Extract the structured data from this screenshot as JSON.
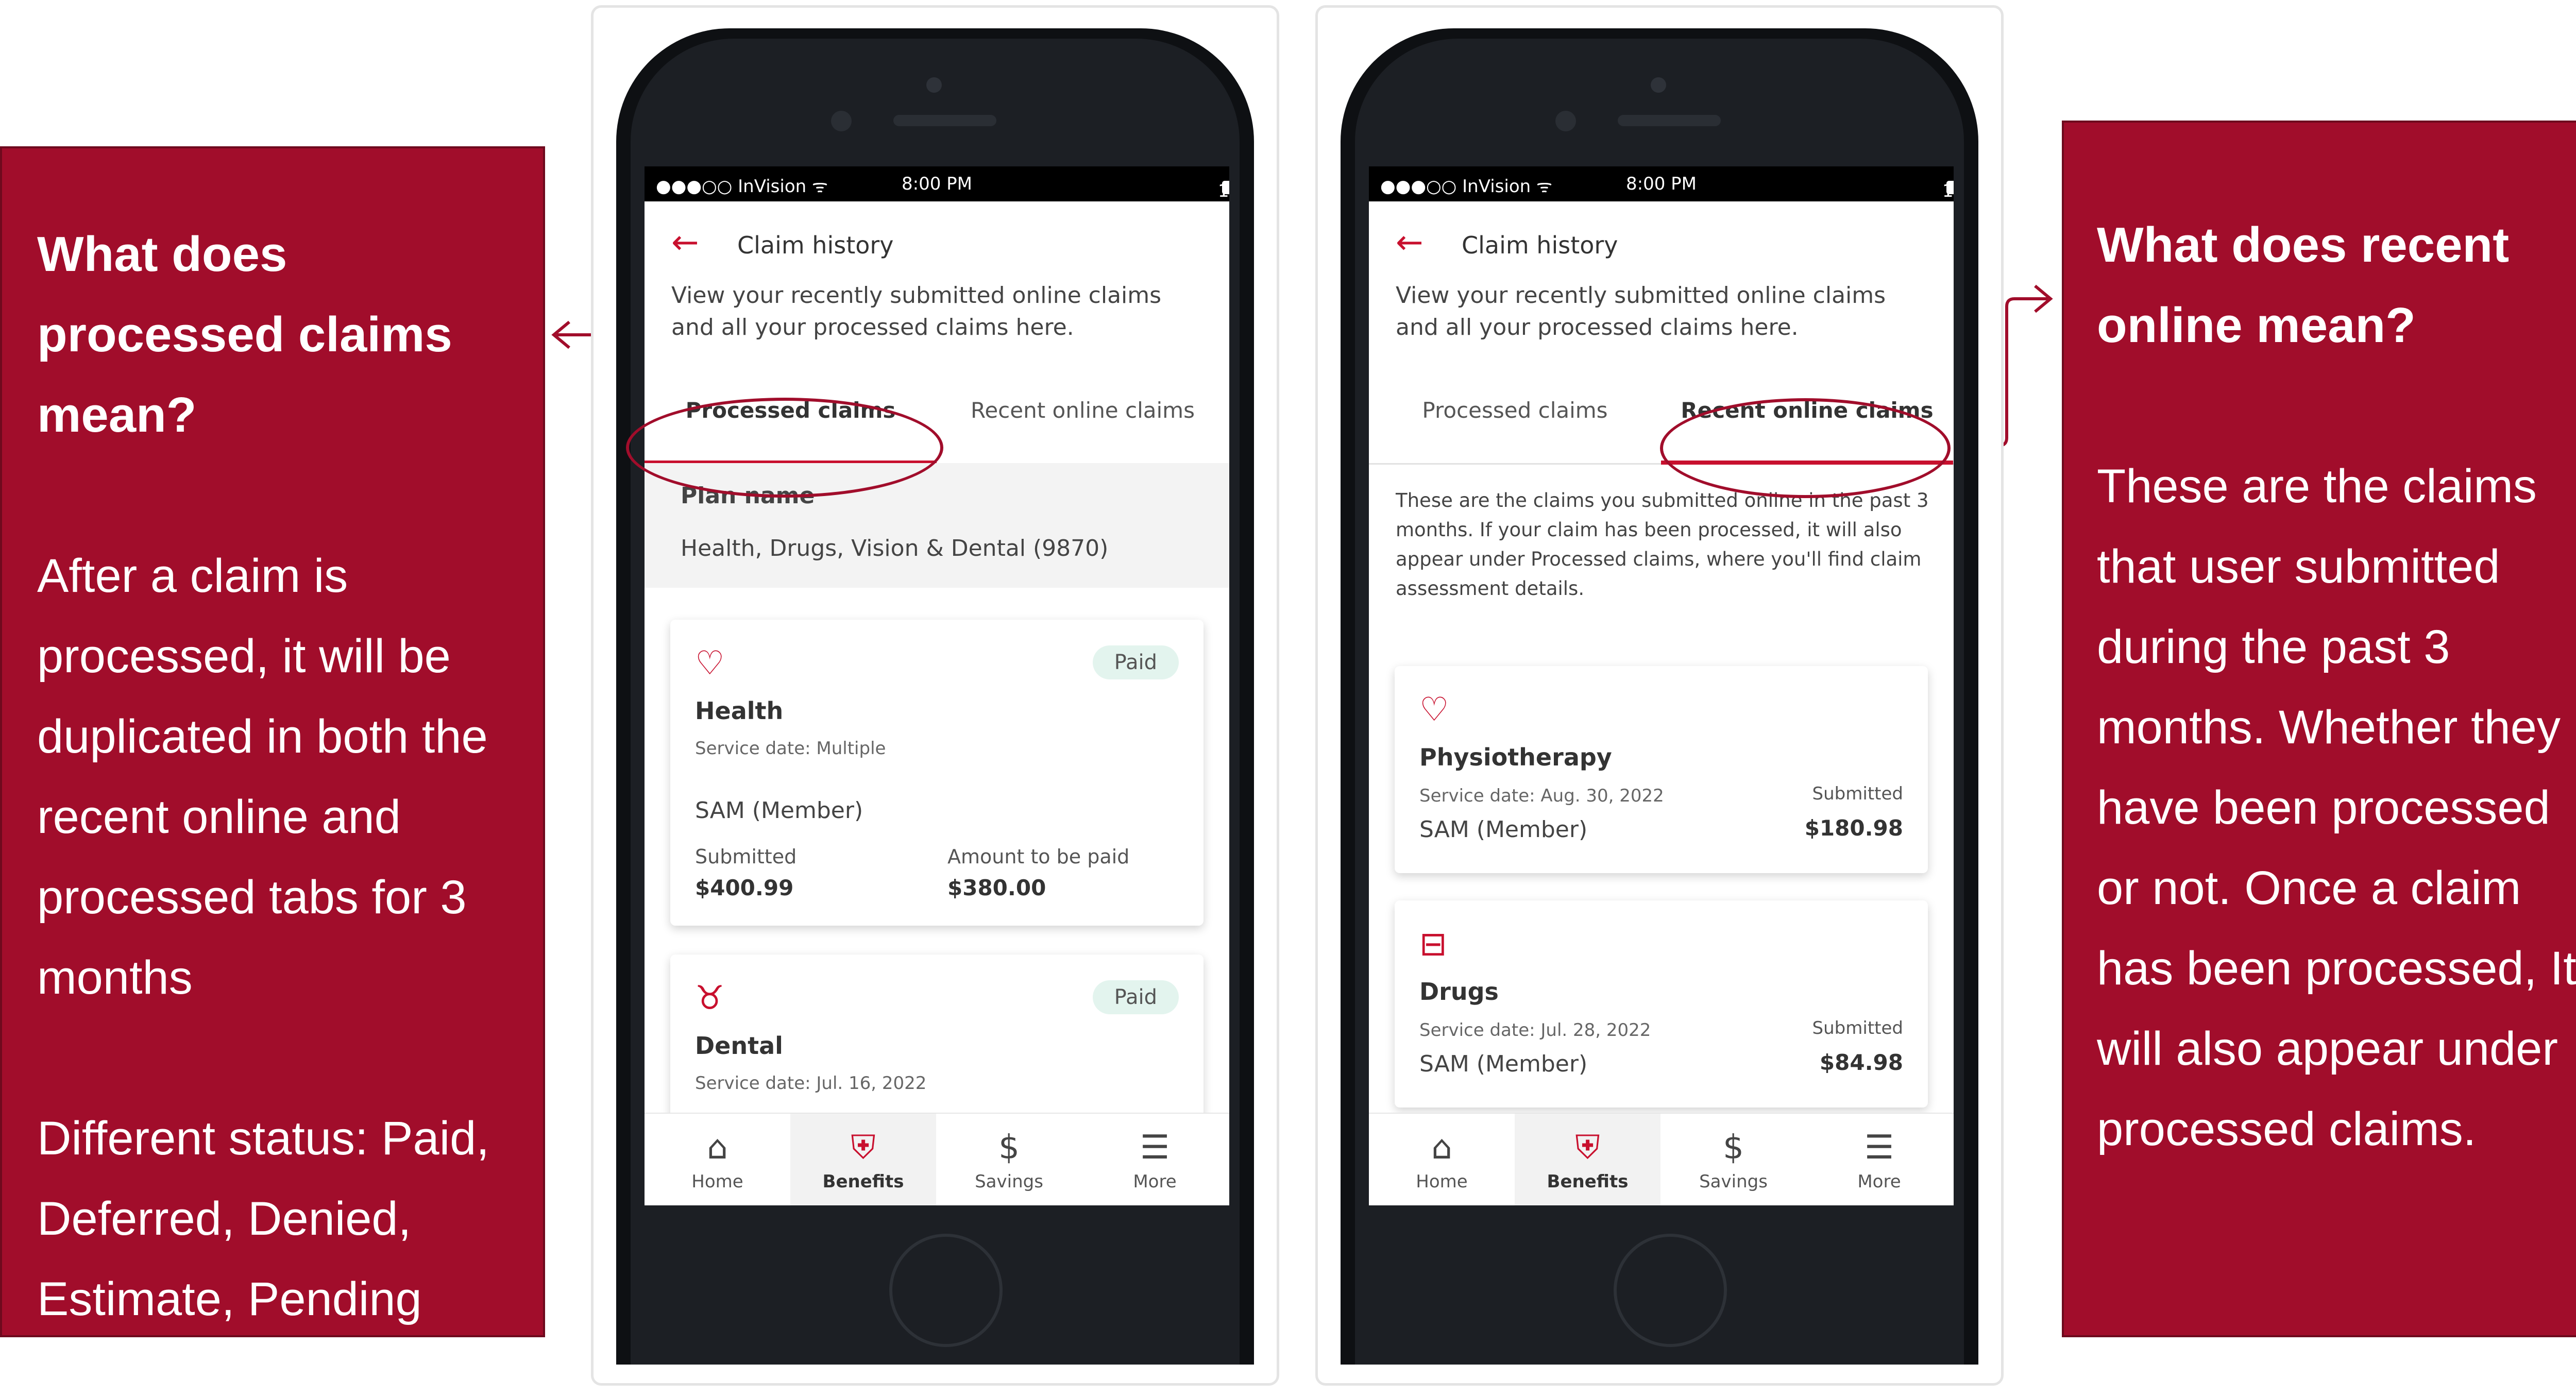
{
  "left_callout": {
    "question": "What does processed claims mean?",
    "explanation": "After a claim is processed, it will be duplicated in both the recent online and processed tabs for 3 months",
    "statuses": "Different status: Paid, Deferred, Denied, Estimate, Pending"
  },
  "right_callout": {
    "question": "What does recent online mean?",
    "explanation": "These are the claims that user submitted during the past 3 months. Whether they have been processed or not.  Once a claim has been processed, It will also appear under processed claims."
  },
  "status_bar": {
    "carrier": "●●●○○ InVision ᯤ",
    "time": "8:00 PM",
    "battery": "100%"
  },
  "screen_left": {
    "title": "Claim history",
    "intro": "View your recently submitted online claims and all your processed claims here.",
    "tabs": [
      "Processed claims",
      "Recent online claims"
    ],
    "active_tab": 0,
    "plan_label": "Plan name",
    "plan_value": "Health, Drugs, Vision & Dental (9870)",
    "claims": [
      {
        "icon": "heart-plus-icon",
        "name": "Health",
        "status": "Paid",
        "service_date": "Service date: Multiple",
        "member": "SAM (Member)",
        "submitted_label": "Submitted",
        "submitted_value": "$400.99",
        "amount_label": "Amount to be paid",
        "amount_value": "$380.00"
      },
      {
        "icon": "tooth-icon",
        "name": "Dental",
        "status": "Paid",
        "service_date": "Service date: Jul. 16, 2022"
      }
    ]
  },
  "screen_right": {
    "title": "Claim history",
    "intro": "View your recently submitted online claims and all your processed claims here.",
    "tabs": [
      "Processed claims",
      "Recent online claims"
    ],
    "active_tab": 1,
    "note": "These are the claims you submitted online in the past 3 months. If your claim has been processed, it will also appear under Processed claims, where you'll find claim assessment details.",
    "claims": [
      {
        "icon": "heart-plus-icon",
        "name": "Physiotherapy",
        "service_date": "Service date: Aug. 30, 2022",
        "member": "SAM (Member)",
        "submitted_label": "Submitted",
        "submitted_value": "$180.98"
      },
      {
        "icon": "pill-bottle-icon",
        "name": "Drugs",
        "service_date": "Service date: Jul. 28, 2022",
        "member": "SAM (Member)",
        "submitted_label": "Submitted",
        "submitted_value": "$84.98"
      }
    ]
  },
  "nav": {
    "items": [
      {
        "label": "Home",
        "icon": "home-icon"
      },
      {
        "label": "Benefits",
        "icon": "shield-plus-icon"
      },
      {
        "label": "Savings",
        "icon": "dollar-circle-icon"
      },
      {
        "label": "More",
        "icon": "menu-icon"
      }
    ],
    "active": 1
  },
  "colors": {
    "brand": "#a10d2b",
    "accent": "#c8102e",
    "badge_bg": "#e3f4ee"
  }
}
